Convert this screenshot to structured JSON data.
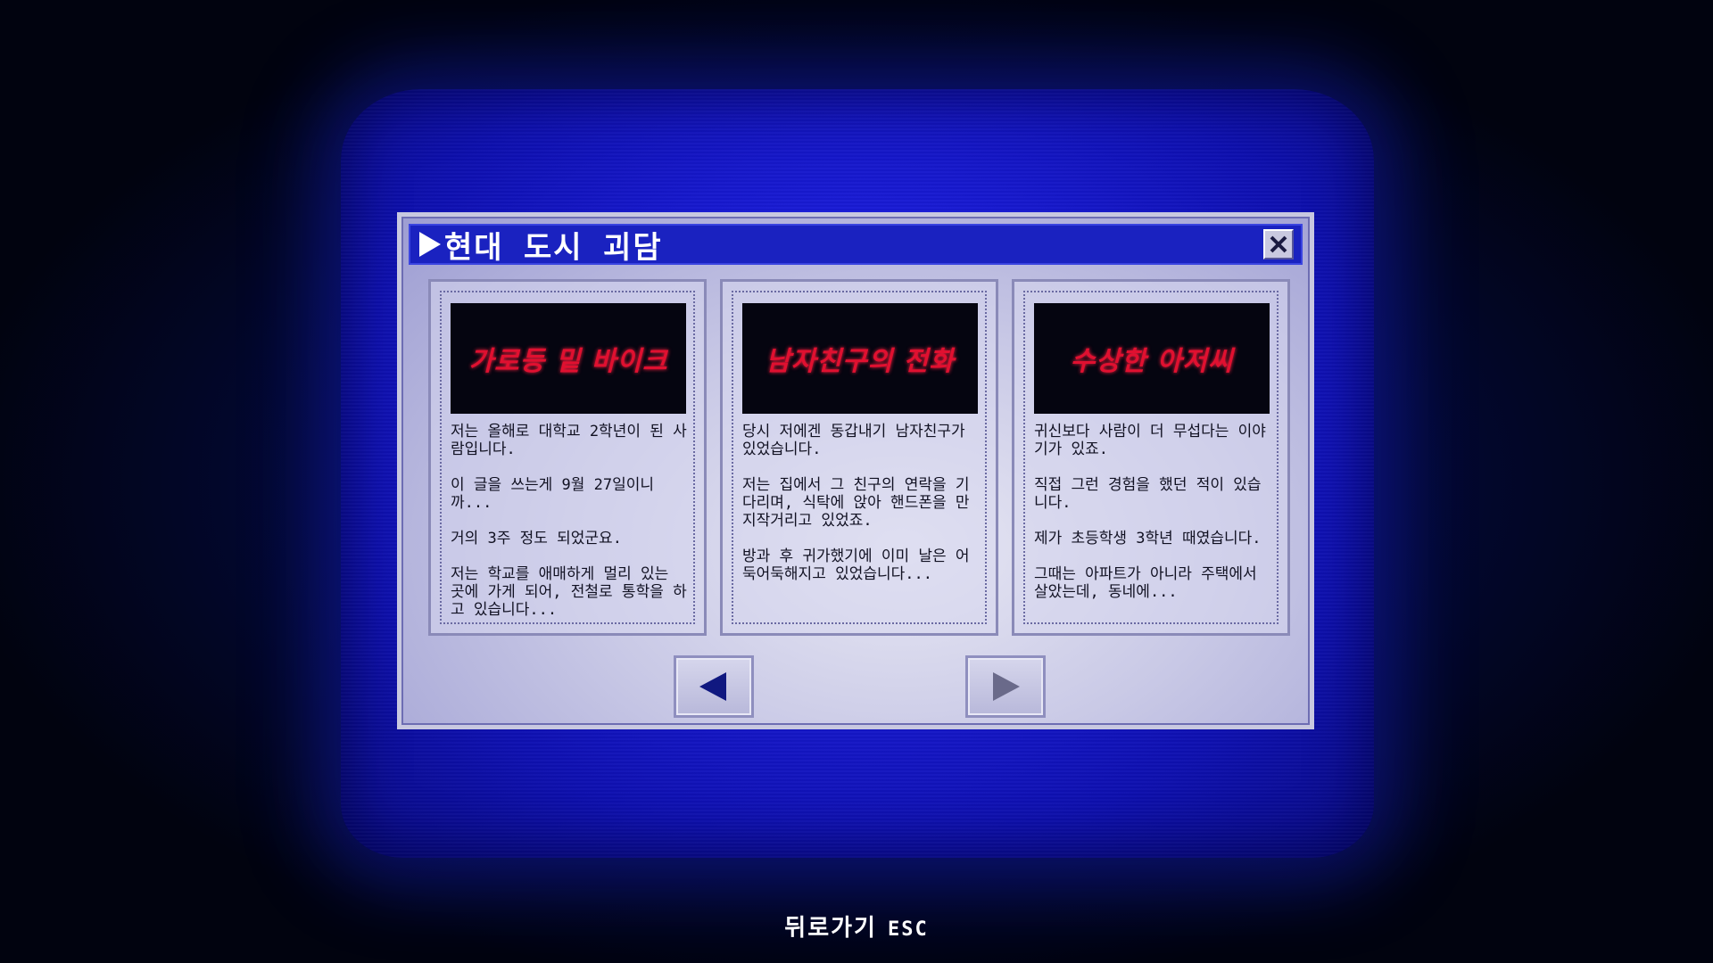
{
  "window": {
    "title": "현대 도시 괴담"
  },
  "stories": [
    {
      "title": "가로등 밑 바이크",
      "excerpt": "저는 올해로 대학교 2학년이 된 사람입니다.\n\n이 글을 쓰는게 9월 27일이니까...\n\n거의 3주 정도 되었군요.\n\n저는 학교를 애매하게 멀리 있는 곳에 가게 되어, 전철로 통학을 하고 있습니다..."
    },
    {
      "title": "남자친구의 전화",
      "excerpt": "당시 저에겐 동갑내기 남자친구가 있었습니다.\n\n저는 집에서 그 친구의 연락을 기다리며, 식탁에 앉아 핸드폰을 만지작거리고 있었죠.\n\n방과 후 귀가했기에 이미 날은 어둑어둑해지고 있었습니다..."
    },
    {
      "title": "수상한 아저씨",
      "excerpt": "귀신보다 사람이 더 무섭다는 이야기가 있죠.\n\n직접 그런 경험을 했던 적이 있습니다.\n\n제가 초등학생 3학년 때였습니다.\n\n그때는 아파트가 아니라 주택에서 살았는데, 동네에..."
    }
  ],
  "footer": {
    "back_label": "뒤로가기",
    "back_key": "ESC"
  },
  "colors": {
    "screen_blue": "#1a1cd8",
    "titlebar_blue": "#1a22c0",
    "story_title_red": "#e01030"
  },
  "icons": {
    "title_marker": "play-triangle-icon",
    "close": "close-icon",
    "prev": "left-triangle-icon",
    "next": "right-triangle-icon"
  }
}
